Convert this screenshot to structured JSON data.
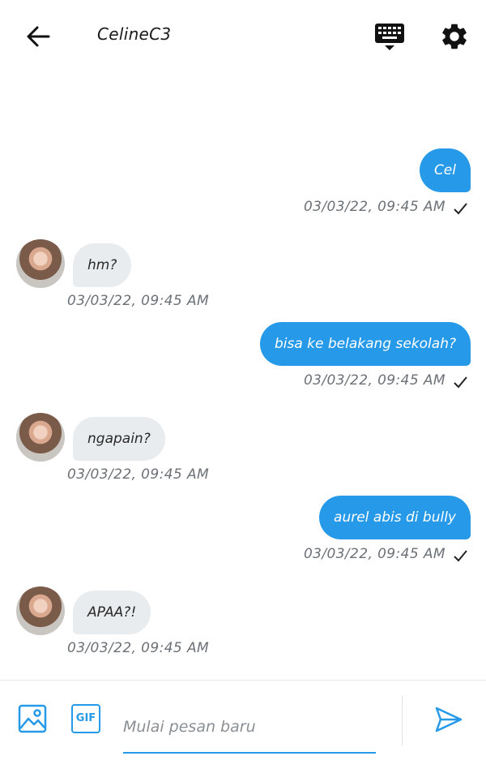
{
  "header": {
    "title": "CelineC3",
    "icons": [
      "arrow-left-icon",
      "keyboard-icon",
      "gear-icon"
    ]
  },
  "messages": [
    {
      "direction": "out",
      "text": "Cel",
      "timestamp": "03/03/22, 09:45 AM",
      "read": true
    },
    {
      "direction": "in",
      "text": "hm?",
      "timestamp": "03/03/22, 09:45 AM"
    },
    {
      "direction": "out",
      "text": "bisa ke belakang sekolah?",
      "timestamp": "03/03/22, 09:45 AM",
      "read": true
    },
    {
      "direction": "in",
      "text": "ngapain?",
      "timestamp": "03/03/22, 09:45 AM"
    },
    {
      "direction": "out",
      "text": "aurel abis di bully",
      "timestamp": "03/03/22, 09:45 AM",
      "read": true
    },
    {
      "direction": "in",
      "text": "APAA?!",
      "timestamp": "03/03/22, 09:45 AM"
    }
  ],
  "composer": {
    "gif_label": "GIF",
    "placeholder": "Mulai pesan baru",
    "value": "",
    "icons": [
      "image-icon",
      "gif-icon",
      "send-icon"
    ]
  },
  "colors": {
    "accent": "#2699e8",
    "incoming_bubble": "#e9ecef",
    "timestamp": "#6b7177"
  }
}
